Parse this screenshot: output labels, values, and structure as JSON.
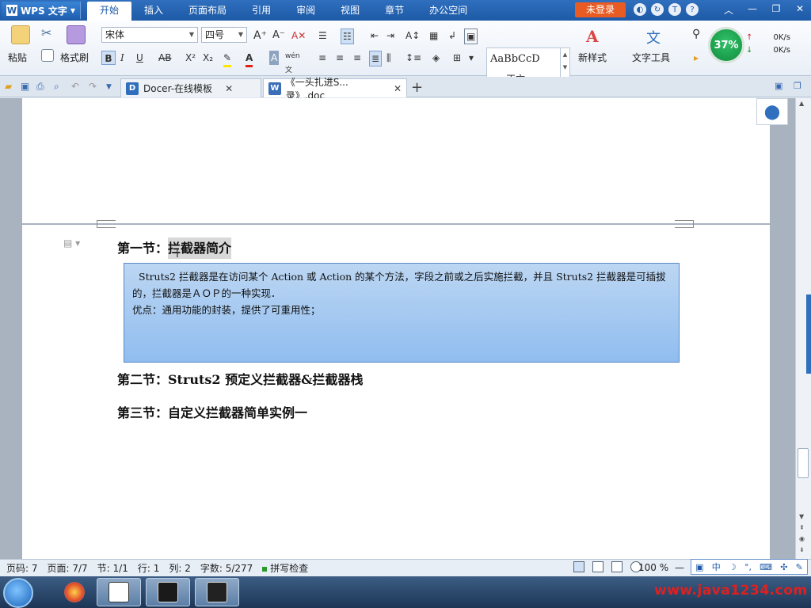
{
  "app": {
    "name": "WPS 文字",
    "menu": [
      "开始",
      "插入",
      "页面布局",
      "引用",
      "审阅",
      "视图",
      "章节",
      "办公空间"
    ],
    "active_menu": "开始",
    "login_label": "未登录"
  },
  "ribbon": {
    "paste": "粘贴",
    "format_painter": "格式刷",
    "font_name": "宋体",
    "font_size": "四号",
    "style_sample": "AaBbCcDc",
    "style_name": "正文",
    "new_style": "新样式",
    "text_tools": "文字工具",
    "gauge_percent": "37%",
    "net_up": "0K/s",
    "net_down": "0K/s"
  },
  "tabs": [
    {
      "label": "Docer-在线模板"
    },
    {
      "label": "《一头扎进S...录》.doc"
    }
  ],
  "document": {
    "heading1_prefix": "第一节：",
    "heading1_highlight": "拦截器简介",
    "note_line1": "Struts2 拦截器是在访问某个 Action 或 Action 的某个方法，字段之前或之后实施拦截，并且 Struts2 拦截器是可插拔的，拦截器是ＡＯＰ的一种实现．",
    "note_line2": "优点：通用功能的封装，提供了可重用性；",
    "heading2": "第二节：Struts2 预定义拦截器&拦截器栈",
    "heading3": "第三节：自定义拦截器简单实例一"
  },
  "status": {
    "page_code": "页码: 7",
    "page": "页面: 7/7",
    "section": "节: 1/1",
    "row": "行: 1",
    "col": "列: 2",
    "words": "字数: 5/277",
    "spell": "拼写检查",
    "zoom": "100 %"
  },
  "ime": {
    "mode": "中"
  },
  "watermark": "www.java1234.com"
}
